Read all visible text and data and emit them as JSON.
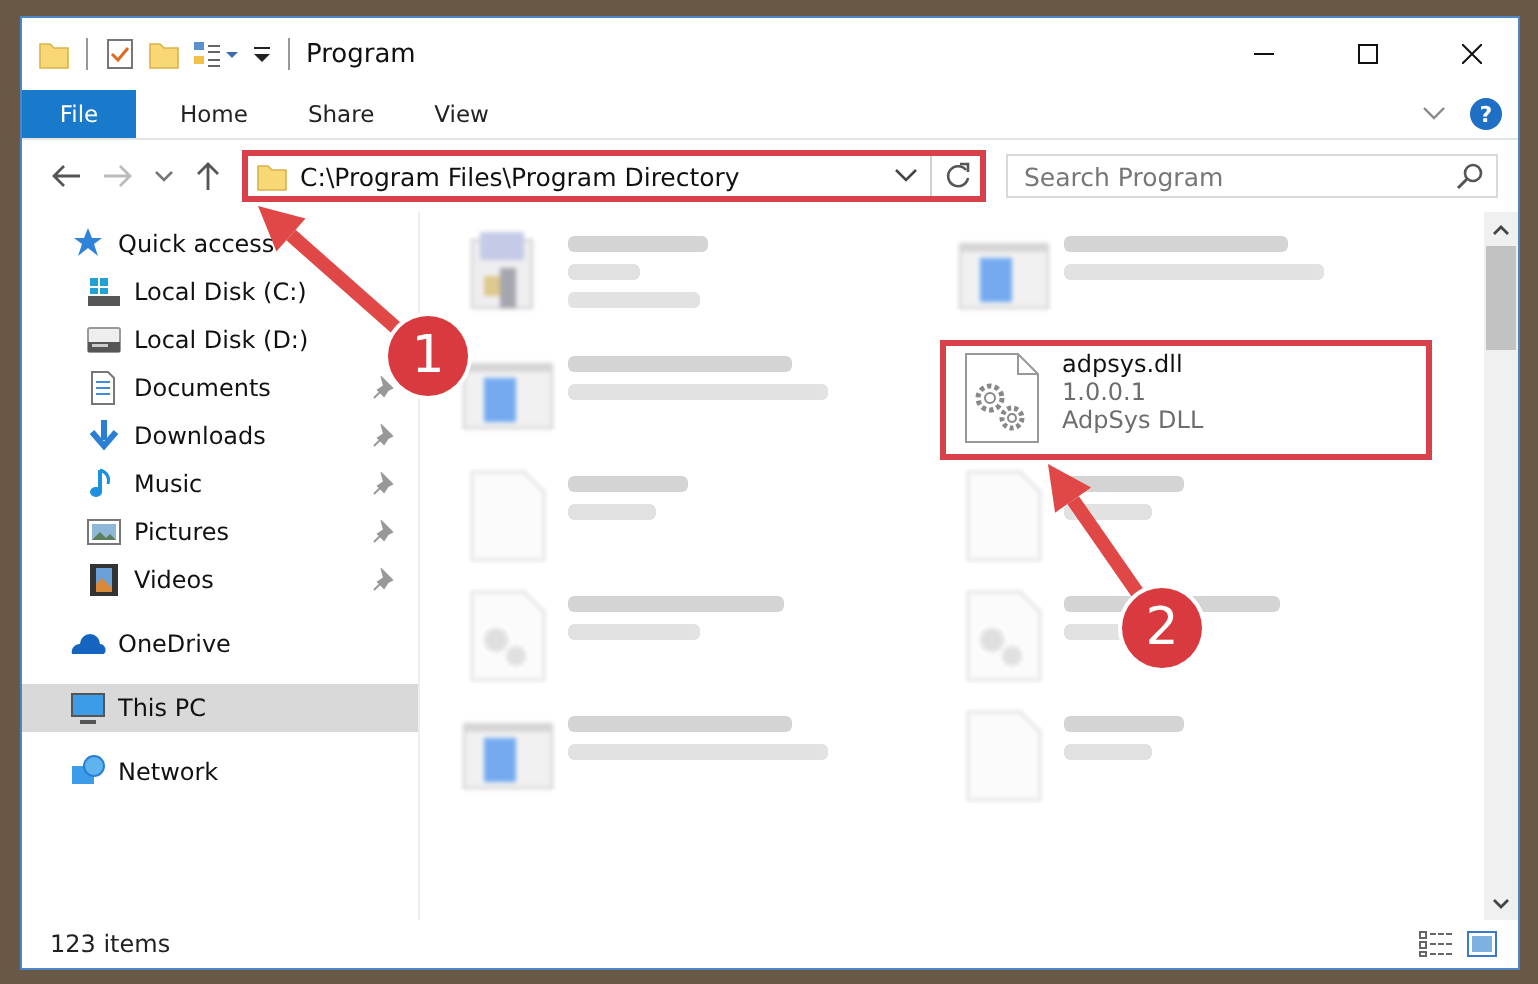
{
  "window": {
    "title": "Program"
  },
  "ribbon": {
    "tabs": [
      {
        "label": "File",
        "kind": "backstage",
        "selected": false
      },
      {
        "label": "Home",
        "kind": "tab",
        "selected": false
      },
      {
        "label": "Share",
        "kind": "tab",
        "selected": false
      },
      {
        "label": "View",
        "kind": "tab",
        "selected": false
      }
    ],
    "help": "?"
  },
  "address_bar": {
    "path": "C:\\Program Files\\Program Directory",
    "highlighted": true
  },
  "search": {
    "placeholder": "Search Program"
  },
  "navigation": {
    "items": [
      {
        "label": "Quick access",
        "kind": "star",
        "selected": false,
        "children": [
          {
            "label": "Local Disk (C:)",
            "kind": "system-drive",
            "selected": false
          },
          {
            "label": "Local Disk (D:)",
            "kind": "drive",
            "selected": false
          },
          {
            "label": "Documents",
            "kind": "documents",
            "pinned": true,
            "selected": false
          },
          {
            "label": "Downloads",
            "kind": "downloads",
            "pinned": true,
            "selected": false
          },
          {
            "label": "Music",
            "kind": "music",
            "pinned": true,
            "selected": false
          },
          {
            "label": "Pictures",
            "kind": "pictures",
            "pinned": true,
            "selected": false
          },
          {
            "label": "Videos",
            "kind": "videos",
            "pinned": true,
            "selected": false
          }
        ]
      },
      {
        "label": "OneDrive",
        "kind": "cloud",
        "selected": false
      },
      {
        "label": "This PC",
        "kind": "computer",
        "selected": true
      },
      {
        "label": "Network",
        "kind": "network",
        "selected": false
      }
    ]
  },
  "files": [
    {
      "kind": "app",
      "blurred": true,
      "highlighted": false
    },
    {
      "kind": "installer",
      "blurred": true,
      "highlighted": false
    },
    {
      "kind": "installer",
      "blurred": true,
      "highlighted": false
    },
    {
      "name": "adpsys.dll",
      "details": [
        "1.0.0.1",
        "AdpSys DLL"
      ],
      "kind": "gear",
      "blurred": false,
      "highlighted": true
    },
    {
      "kind": "blank",
      "blurred": true,
      "highlighted": false
    },
    {
      "kind": "blank",
      "blurred": true,
      "highlighted": false
    },
    {
      "kind": "dll",
      "blurred": true,
      "highlighted": false
    },
    {
      "kind": "dll",
      "blurred": true,
      "highlighted": false
    },
    {
      "kind": "installer",
      "blurred": true,
      "highlighted": false
    },
    {
      "kind": "blank",
      "blurred": true,
      "highlighted": false
    }
  ],
  "status_bar": {
    "item_count": "123 items"
  },
  "annotations": [
    {
      "number": "1"
    },
    {
      "number": "2"
    }
  ]
}
